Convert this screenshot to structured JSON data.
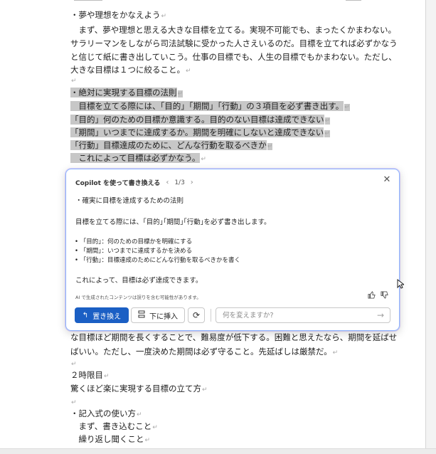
{
  "document": {
    "paragraph_mark": "↵",
    "lines_top": [
      "・夢や理想をかなえよう",
      "　まず、夢や理想と思える大きな目標を立てる。実現不可能でも、まったくかまわない。",
      "サラリーマンをしながら司法試験に受かった人さえいるのだ。目標を立てれば必ずかなう",
      "と信じて紙に書き出していこう。仕事の目標でも、人生の目標でもかまわない。ただし、",
      "大きな目標は１つに絞ること。",
      "",
      "・絶対に実現する目標の法則",
      "　目標を立てる際には、「目的」「期間」「行動」の３項目を必ず書き出す。",
      "「目的」何のための目標か意識する。目的のない目標は達成できない",
      "「期間」いつまでに達成するか。期間を明確にしないと達成できない",
      "「行動」目標達成のために、どんな行動を取るべきか",
      "　これによって目標は必ずかなう。"
    ],
    "lines_bottom": [
      "な目標ほど期間を長くすることで、難易度が低下する。困難と思えたなら、期間を延ばせ",
      "ばいい。ただし、一度決めた期間は必ず守ること。先延ばしは厳禁だ。",
      "",
      "２時限目",
      "驚くほど楽に実現する目標の立て方",
      "",
      "・記入式の使い方",
      "　まず、書き込むこと",
      "　繰り返し聞くこと"
    ]
  },
  "copilot": {
    "title": "Copilot を使って書き換える",
    "prev_icon": "chevron-left-icon",
    "next_icon": "chevron-right-icon",
    "counter": "1/3",
    "close_icon": "close-icon",
    "heading": "・確実に目標を達成するための法則",
    "intro": "目標を立てる際には、｢目的｣｢期間｣｢行動｣を必ず書き出します。",
    "bullets": [
      "｢目的｣：何のための目標かを明確にする",
      "｢期間｣：いつまでに達成するかを決める",
      "｢行動｣：目標達成のためにどんな行動を取るべきかを書く"
    ],
    "conclusion": "これによって、目標は必ず達成できます。",
    "disclaimer": "AI で生成されたコンテンツは誤りを含む可能性があります。",
    "like_icon": "thumbs-up-icon",
    "dislike_icon": "thumbs-down-icon",
    "replace_label": "置き換え",
    "insert_label": "下に挿入",
    "regenerate_icon": "refresh-icon",
    "input_placeholder": "何を変えますか?",
    "send_icon": "send-arrow-icon",
    "accent_color": "#1b5fc4",
    "highlight_color": "#c7c7c7"
  }
}
